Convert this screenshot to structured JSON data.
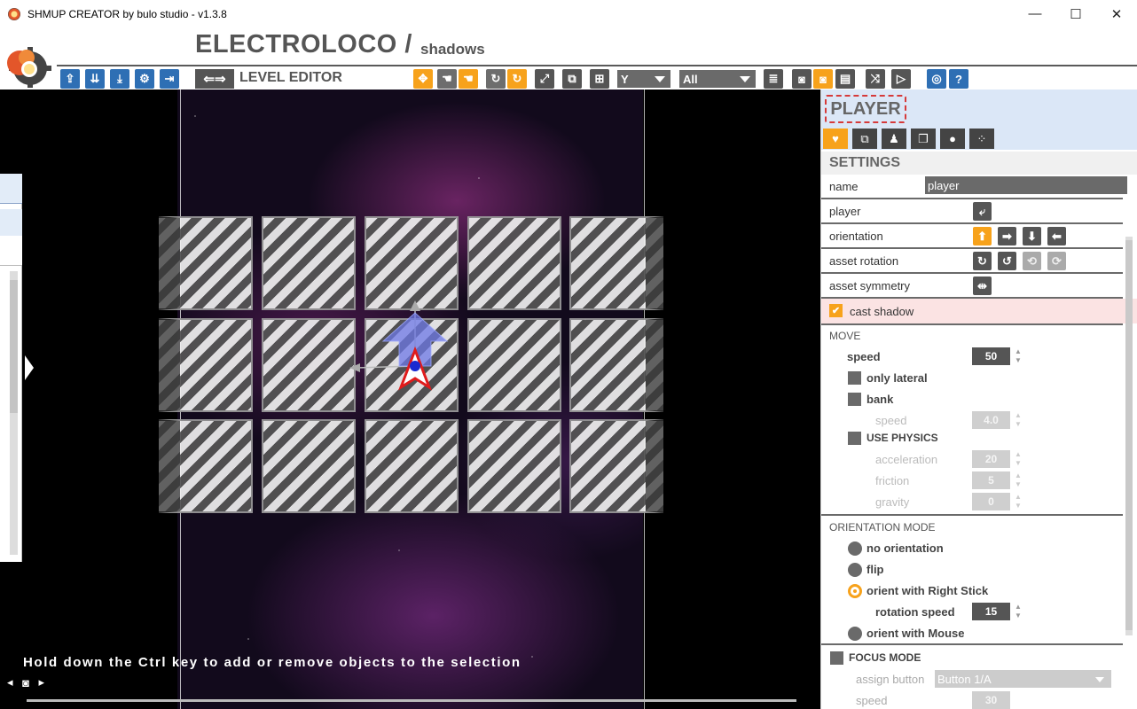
{
  "window": {
    "title": "SHMUP CREATOR by bulo studio - v1.3.8",
    "minimize": "—",
    "maximize": "☐",
    "close": "✕"
  },
  "header": {
    "project_name": "ELECTROLOCO /",
    "level_name": "shadows",
    "editor_label": "LEVEL EDITOR",
    "axis_select": "Y",
    "filter_select": "All"
  },
  "canvas": {
    "hint": "Hold down the Ctrl key to add or remove objects to the selection"
  },
  "panel": {
    "object_title": "PLAYER",
    "settings_title": "SETTINGS",
    "name_label": "name",
    "name_value": "player",
    "player_label": "player",
    "orientation_label": "orientation",
    "asset_rotation_label": "asset rotation",
    "asset_symmetry_label": "asset symmetry",
    "cast_shadow_label": "cast shadow",
    "move": {
      "title": "MOVE",
      "speed_label": "speed",
      "speed_value": "50",
      "only_lateral": "only lateral",
      "bank": "bank",
      "bank_speed_label": "speed",
      "bank_speed_value": "4.0",
      "use_physics": "USE PHYSICS",
      "acceleration_label": "acceleration",
      "acceleration_value": "20",
      "friction_label": "friction",
      "friction_value": "5",
      "gravity_label": "gravity",
      "gravity_value": "0"
    },
    "orientation_mode": {
      "title": "ORIENTATION MODE",
      "no_orientation": "no orientation",
      "flip": "flip",
      "right_stick": "orient with Right Stick",
      "rotation_speed_label": "rotation speed",
      "rotation_speed_value": "15",
      "mouse": "orient with Mouse"
    },
    "focus_mode": {
      "title": "FOCUS MODE",
      "assign_button_label": "assign button",
      "assign_button_value": "Button 1/A",
      "speed_label": "speed",
      "speed_value": "30"
    }
  },
  "colors": {
    "accent": "#f7a21b",
    "toolbar_blue": "#2e6fb4",
    "panel_header": "#dbe7f7",
    "selection_red": "#d63a3a"
  }
}
